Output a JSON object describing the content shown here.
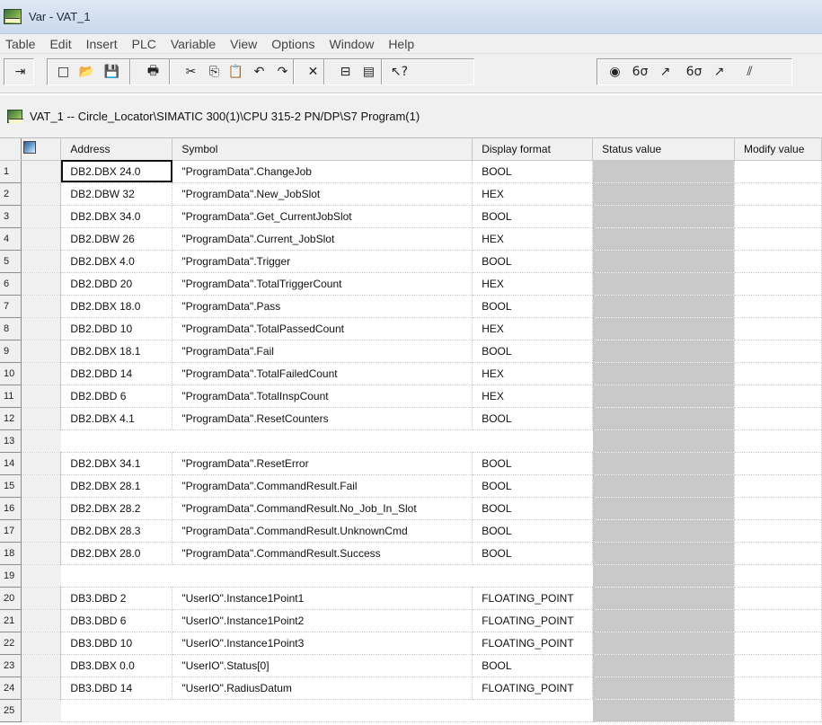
{
  "window": {
    "title": "Var - VAT_1"
  },
  "menu": [
    "Table",
    "Edit",
    "Insert",
    "PLC",
    "Variable",
    "View",
    "Options",
    "Window",
    "Help"
  ],
  "toolbar": {
    "buttons": [
      {
        "name": "pin-icon",
        "glyph": "⇥"
      },
      {
        "name": "new-icon",
        "glyph": "□"
      },
      {
        "name": "open-icon",
        "glyph": "📂"
      },
      {
        "name": "save-icon",
        "glyph": "💾"
      },
      {
        "name": "print-icon",
        "glyph": "🖶"
      },
      {
        "name": "cut-icon",
        "glyph": "✂"
      },
      {
        "name": "copy-icon",
        "glyph": "⎘"
      },
      {
        "name": "paste-icon",
        "glyph": "📋"
      },
      {
        "name": "undo-icon",
        "glyph": "↶"
      },
      {
        "name": "redo-icon",
        "glyph": "↷"
      },
      {
        "name": "delete-icon",
        "glyph": "✕"
      },
      {
        "name": "accessible-nodes-icon",
        "glyph": "⊟"
      },
      {
        "name": "module-icon",
        "glyph": "▤"
      },
      {
        "name": "help-pointer-icon",
        "glyph": "↖?"
      },
      {
        "name": "monitor-icon",
        "glyph": "◉"
      },
      {
        "name": "monitor-variable-icon",
        "glyph": "6σ"
      },
      {
        "name": "modify-variable-icon",
        "glyph": "↗"
      },
      {
        "name": "update-monitor-icon",
        "glyph": "6σ"
      },
      {
        "name": "activate-modify-icon",
        "glyph": "↗"
      },
      {
        "name": "force-icon",
        "glyph": "⫽"
      }
    ]
  },
  "subwindow": {
    "title": "VAT_1 -- Circle_Locator\\SIMATIC 300(1)\\CPU 315-2 PN/DP\\S7 Program(1)"
  },
  "table": {
    "columns": [
      "Address",
      "Symbol",
      "Display format",
      "Status value",
      "Modify value"
    ],
    "rows": [
      {
        "n": "1",
        "address": "DB2.DBX  24.0",
        "symbol": "\"ProgramData\".ChangeJob",
        "format": "BOOL",
        "selected": true
      },
      {
        "n": "2",
        "address": "DB2.DBW  32",
        "symbol": "\"ProgramData\".New_JobSlot",
        "format": "HEX"
      },
      {
        "n": "3",
        "address": "DB2.DBX  34.0",
        "symbol": "\"ProgramData\".Get_CurrentJobSlot",
        "format": "BOOL"
      },
      {
        "n": "4",
        "address": "DB2.DBW  26",
        "symbol": "\"ProgramData\".Current_JobSlot",
        "format": "HEX"
      },
      {
        "n": "5",
        "address": "DB2.DBX   4.0",
        "symbol": "\"ProgramData\".Trigger",
        "format": "BOOL"
      },
      {
        "n": "6",
        "address": "DB2.DBD  20",
        "symbol": "\"ProgramData\".TotalTriggerCount",
        "format": "HEX"
      },
      {
        "n": "7",
        "address": "DB2.DBX  18.0",
        "symbol": "\"ProgramData\".Pass",
        "format": "BOOL"
      },
      {
        "n": "8",
        "address": "DB2.DBD  10",
        "symbol": "\"ProgramData\".TotalPassedCount",
        "format": "HEX"
      },
      {
        "n": "9",
        "address": "DB2.DBX  18.1",
        "symbol": "\"ProgramData\".Fail",
        "format": "BOOL"
      },
      {
        "n": "10",
        "address": "DB2.DBD  14",
        "symbol": "\"ProgramData\".TotalFailedCount",
        "format": "HEX"
      },
      {
        "n": "11",
        "address": "DB2.DBD   6",
        "symbol": "\"ProgramData\".TotalInspCount",
        "format": "HEX"
      },
      {
        "n": "12",
        "address": "DB2.DBX   4.1",
        "symbol": "\"ProgramData\".ResetCounters",
        "format": "BOOL"
      },
      {
        "n": "13",
        "address": "",
        "symbol": "",
        "format": "",
        "empty": true
      },
      {
        "n": "14",
        "address": "DB2.DBX  34.1",
        "symbol": "\"ProgramData\".ResetError",
        "format": "BOOL"
      },
      {
        "n": "15",
        "address": "DB2.DBX  28.1",
        "symbol": "\"ProgramData\".CommandResult.Fail",
        "format": "BOOL"
      },
      {
        "n": "16",
        "address": "DB2.DBX  28.2",
        "symbol": "\"ProgramData\".CommandResult.No_Job_In_Slot",
        "format": "BOOL"
      },
      {
        "n": "17",
        "address": "DB2.DBX  28.3",
        "symbol": "\"ProgramData\".CommandResult.UnknownCmd",
        "format": "BOOL"
      },
      {
        "n": "18",
        "address": "DB2.DBX  28.0",
        "symbol": "\"ProgramData\".CommandResult.Success",
        "format": "BOOL"
      },
      {
        "n": "19",
        "address": "",
        "symbol": "",
        "format": "",
        "empty": true
      },
      {
        "n": "20",
        "address": "DB3.DBD   2",
        "symbol": "\"UserIO\".Instance1Point1",
        "format": "FLOATING_POINT"
      },
      {
        "n": "21",
        "address": "DB3.DBD   6",
        "symbol": "\"UserIO\".Instance1Point2",
        "format": "FLOATING_POINT"
      },
      {
        "n": "22",
        "address": "DB3.DBD  10",
        "symbol": "\"UserIO\".Instance1Point3",
        "format": "FLOATING_POINT"
      },
      {
        "n": "23",
        "address": "DB3.DBX   0.0",
        "symbol": "\"UserIO\".Status[0]",
        "format": "BOOL"
      },
      {
        "n": "24",
        "address": "DB3.DBD  14",
        "symbol": "\"UserIO\".RadiusDatum",
        "format": "FLOATING_POINT"
      },
      {
        "n": "25",
        "address": "",
        "symbol": "",
        "format": "",
        "empty": true
      }
    ]
  }
}
